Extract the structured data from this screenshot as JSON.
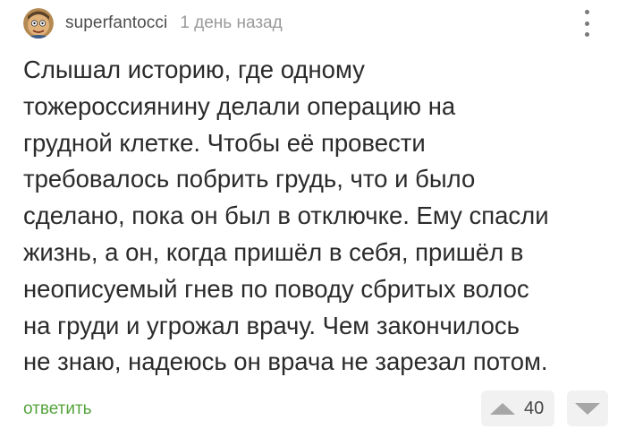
{
  "comment": {
    "author": "superfantocci",
    "time": "1 день назад",
    "text": "Слышал историю, где одному\nтожероссиянину делали операцию на\nгрудной клетке. Чтобы её провести\nтребовалось побрить грудь, что и было\nсделано, пока он был в отключке. Ему спасли\nжизнь, а он, когда пришёл в себя, пришёл в\nнеописуемый гнев по поводу сбритых волос\nна груди и угрожал врачу. Чем закончилось\nне знаю, надеюсь он врача не зарезал потом.",
    "reply_label": "ответить",
    "rating": "40"
  },
  "icons": {
    "avatar": "avatar-image",
    "more": "more-vertical-icon",
    "upvote": "arrow-up-icon",
    "downvote": "arrow-down-icon"
  },
  "colors": {
    "reply": "#56a43e",
    "author": "#4d4d4d",
    "time": "#9a9a9a",
    "text": "#2b2b2b",
    "vote_bg": "#f1f1f1",
    "vote_arrow": "#a6a6a6"
  }
}
